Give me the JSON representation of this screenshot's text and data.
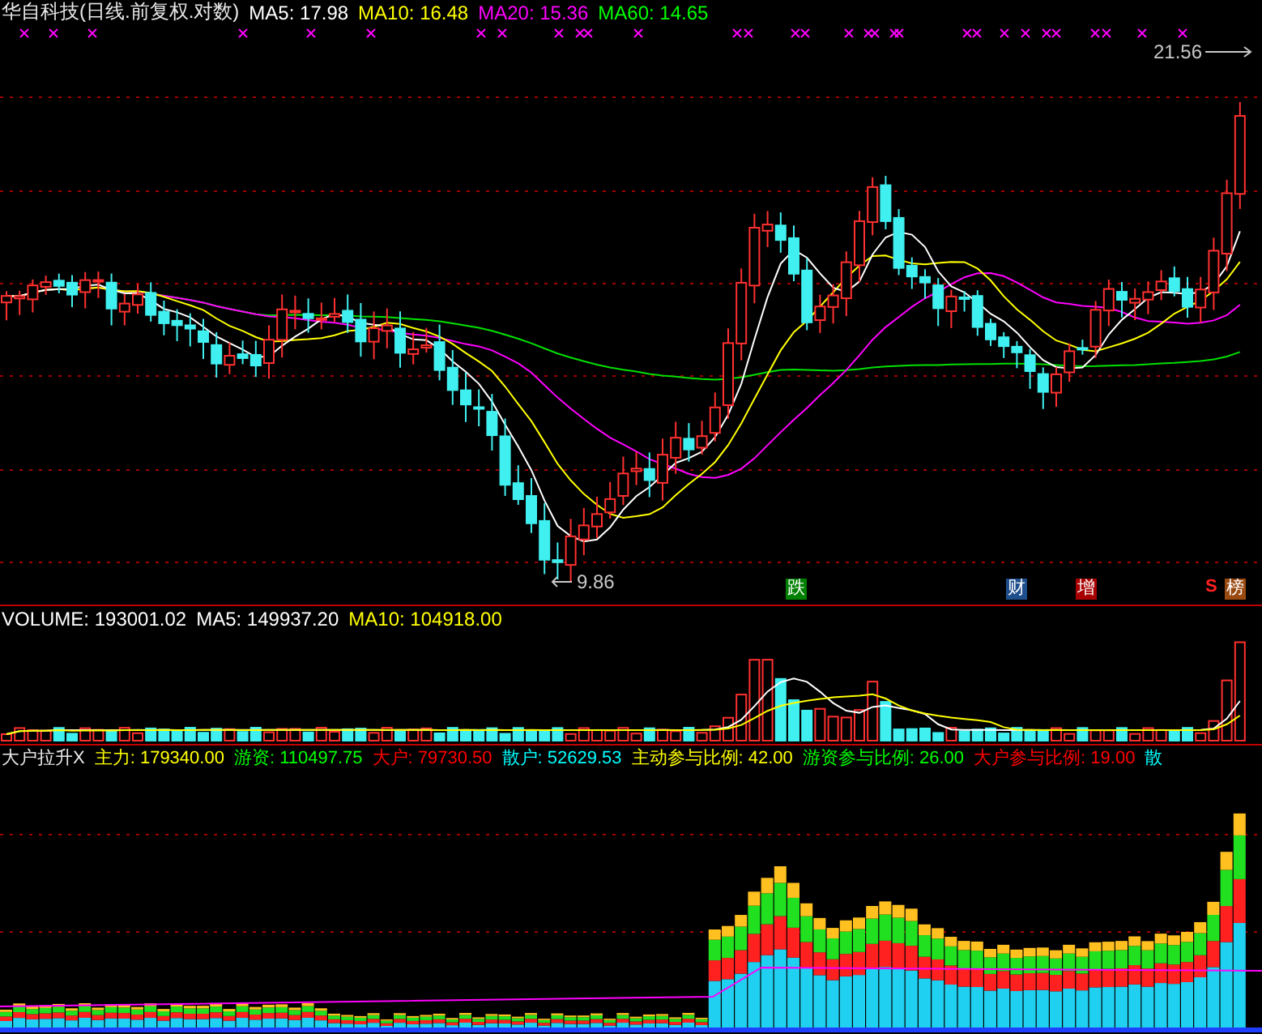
{
  "price_panel": {
    "title": "华自科技(日线.前复权.对数)",
    "indicators": [
      {
        "label": "MA5: 17.98",
        "color": "#ffffff"
      },
      {
        "label": "MA10: 16.48",
        "color": "#ffff00"
      },
      {
        "label": "MA20: 15.36",
        "color": "#ff00ff"
      },
      {
        "label": "MA60: 14.65",
        "color": "#00ff00"
      }
    ],
    "high_label": "21.56",
    "low_label": "9.86",
    "event_badges": [
      {
        "label": "跌",
        "color": "#008000"
      },
      {
        "label": "财",
        "color": "#1f4e8c"
      },
      {
        "label": "增",
        "color": "#a80000"
      },
      {
        "label": "榜",
        "color": "#9a4a10"
      }
    ],
    "signal_mark": "S"
  },
  "volume_panel": {
    "indicators": [
      {
        "label": "VOLUME: 193001.02",
        "color": "#ffffff"
      },
      {
        "label": "MA5: 149937.20",
        "color": "#ffffff"
      },
      {
        "label": "MA10: 104918.00",
        "color": "#ffff00"
      }
    ]
  },
  "capital_panel": {
    "title": "大户拉升X",
    "indicators": [
      {
        "label": "主力: 179340.00",
        "color": "#ffff00"
      },
      {
        "label": "游资: 110497.75",
        "color": "#00ff00"
      },
      {
        "label": "大户: 79730.50",
        "color": "#ff0000"
      },
      {
        "label": "散户: 52629.53",
        "color": "#00ffff"
      },
      {
        "label": "主动参与比例: 42.00",
        "color": "#ffff00"
      },
      {
        "label": "游资参与比例: 26.00",
        "color": "#00ff00"
      },
      {
        "label": "大户参与比例: 19.00",
        "color": "#ff0000"
      },
      {
        "label": "散",
        "color": "#00ffff"
      }
    ]
  }
}
